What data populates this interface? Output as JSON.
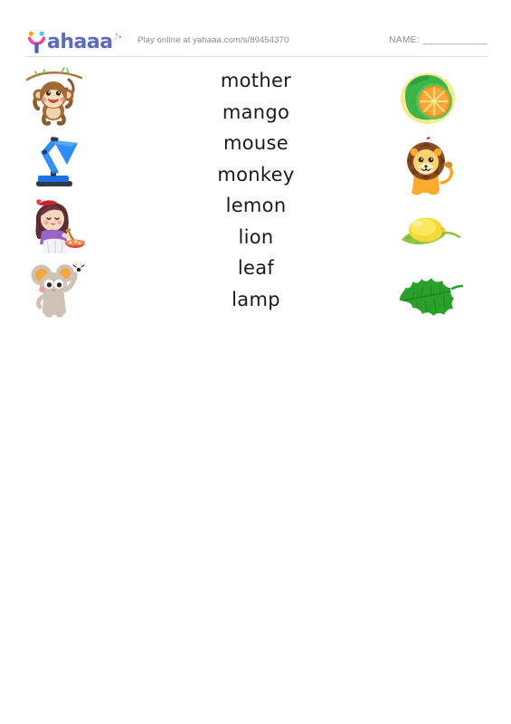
{
  "header": {
    "logo_name": "yahaaa-logo",
    "logo_text": "ahaaa",
    "play_text": "Play online at yahaaa.com/s/89454370",
    "name_label": "NAME:",
    "name_line": "______________"
  },
  "colors": {
    "logo_text": "#5b6bb5",
    "logo_dot_left": "#f5a623",
    "logo_dot_right": "#45cfe0",
    "logo_smile": "#ef4a9b",
    "logo_stem": "#4a5fc1",
    "muted_text": "#8b8b8b",
    "rule": "#dedede",
    "word_text": "#1a1a1a"
  },
  "words": [
    {
      "text": "mother"
    },
    {
      "text": "mango"
    },
    {
      "text": "mouse"
    },
    {
      "text": "monkey"
    },
    {
      "text": "lemon"
    },
    {
      "text": "lion"
    },
    {
      "text": "leaf"
    },
    {
      "text": "lamp"
    }
  ],
  "left_pictures": [
    {
      "name": "monkey-picture",
      "label": "monkey"
    },
    {
      "name": "lamp-picture",
      "label": "lamp"
    },
    {
      "name": "mother-picture",
      "label": "mother"
    },
    {
      "name": "mouse-picture",
      "label": "mouse"
    }
  ],
  "right_pictures": [
    {
      "name": "mango-picture",
      "label": "mango"
    },
    {
      "name": "lion-picture",
      "label": "lion"
    },
    {
      "name": "lemon-picture",
      "label": "lemon"
    },
    {
      "name": "leaf-picture",
      "label": "leaf"
    }
  ]
}
